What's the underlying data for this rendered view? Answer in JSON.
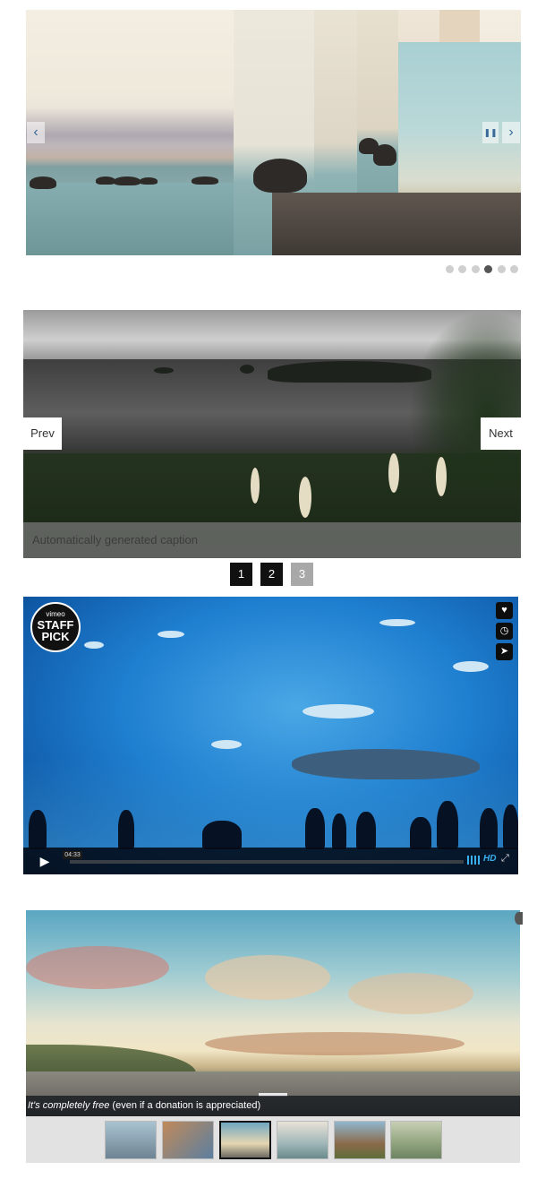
{
  "slider1": {
    "prev_arrow": "‹",
    "next_arrow": "›",
    "pause_icon": "❚❚",
    "dots_count": 6,
    "active_dot": 4
  },
  "slider2": {
    "prev_label": "Prev",
    "next_label": "Next",
    "caption": "Automatically generated caption",
    "pages": [
      "1",
      "2",
      "3"
    ]
  },
  "video": {
    "badge_top": "vimeo",
    "badge_line1": "STAFF",
    "badge_line2": "PICK",
    "time": "04:33",
    "hd_label": "HD",
    "play_icon": "play-icon",
    "like_icon": "heart-icon",
    "later_icon": "clock-icon",
    "share_icon": "send-icon"
  },
  "slider4": {
    "caption_italic": "It's completely free",
    "caption_rest": " (even if a donation is appreciated)",
    "thumbnail_count": 6,
    "active_thumbnail": 3
  }
}
